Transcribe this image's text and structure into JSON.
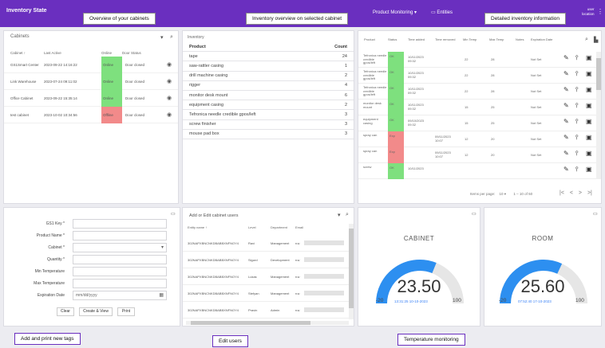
{
  "app": {
    "title": "Inventory State",
    "menu_label": "Product Monitoring ▾",
    "entities_label": "Entities",
    "user_line1": "user",
    "user_line2": "location"
  },
  "callouts": {
    "cabinets": "Overview of your cabinets",
    "inventory": "Inventory overview on selected cabinet",
    "detailed": "Detailed inventory information",
    "tags": "Add and print new tags",
    "users": "Edit users",
    "temp": "Temperature monitoring"
  },
  "cabinets": {
    "title": "Cabinets",
    "columns": [
      "Cabinet ↑",
      "Last Active",
      "Online",
      "Door Status"
    ],
    "rows": [
      {
        "name": "GS1Smart Center",
        "date": "2023-09-22 14:16:22",
        "online": "Online",
        "door": "Door closed",
        "ok": true
      },
      {
        "name": "Link Warehouse",
        "date": "2023-07-24 09:11:02",
        "online": "Online",
        "door": "Door closed",
        "ok": true
      },
      {
        "name": "Office Cabinet",
        "date": "2023-09-22 15:35:14",
        "online": "Online",
        "door": "Door closed",
        "ok": true
      },
      {
        "name": "test cabinet",
        "date": "2023-10-02 10:34:56",
        "online": "Offline",
        "door": "Door closed",
        "ok": false
      }
    ]
  },
  "inventory": {
    "title": "Inventory",
    "col_product": "Product",
    "col_count": "Count",
    "rows": [
      {
        "product": "tape",
        "count": "24"
      },
      {
        "product": "saw-rattler casing",
        "count": "1"
      },
      {
        "product": "drill machine casing",
        "count": "2"
      },
      {
        "product": "rigger",
        "count": "4"
      },
      {
        "product": "monitor desk mount",
        "count": "6"
      },
      {
        "product": "equipment casing",
        "count": "2"
      },
      {
        "product": "Tefronica needle credible gpos/left",
        "count": "3"
      },
      {
        "product": "screw finisher",
        "count": "3"
      },
      {
        "product": "mouse pad box",
        "count": "3"
      }
    ]
  },
  "detail": {
    "columns": [
      "Product",
      "Status",
      "Time added",
      "Time removed",
      "Min Temp",
      "Max Temp",
      "Notes",
      "Expiration Date"
    ],
    "rows": [
      {
        "product": "Tefronica needle credible gpos/left",
        "status": "OK",
        "added": "10/11/2023 09:32",
        "removed": "",
        "min": "22",
        "max": "28",
        "exp": "Not Set",
        "bad": false
      },
      {
        "product": "Tefronica needle credible gpos/left",
        "status": "OK",
        "added": "10/11/2023 09:32",
        "removed": "",
        "min": "22",
        "max": "28",
        "exp": "Not Set",
        "bad": false
      },
      {
        "product": "Tefronica needle credible gpos/left",
        "status": "OK",
        "added": "10/11/2023 09:32",
        "removed": "",
        "min": "22",
        "max": "28",
        "exp": "Not Set",
        "bad": false
      },
      {
        "product": "monitor desk mount",
        "status": "OK",
        "added": "10/11/2023 09:32",
        "removed": "",
        "min": "15",
        "max": "25",
        "exp": "Not Set",
        "bad": false
      },
      {
        "product": "equipment casing",
        "status": "OK",
        "added": "09/10/2023 09:32",
        "removed": "",
        "min": "15",
        "max": "25",
        "exp": "Not Set",
        "bad": false
      },
      {
        "product": "spray can",
        "status": "Exp",
        "added": "",
        "removed": "09/11/2023 10:07",
        "min": "12",
        "max": "20",
        "exp": "Not Set",
        "bad": true
      },
      {
        "product": "spray can",
        "status": "Exp",
        "added": "",
        "removed": "09/11/2023 10:07",
        "min": "12",
        "max": "20",
        "exp": "Not Set",
        "bad": true
      },
      {
        "product": "screw",
        "status": "OK",
        "added": "10/11/2023",
        "removed": "",
        "min": "",
        "max": "",
        "exp": "",
        "bad": false
      }
    ],
    "pager_label": "Items per page:",
    "pager_size": "10 ▾",
    "pager_range": "1 – 10 of 50"
  },
  "tags": {
    "fields": [
      {
        "label": "GS1 Key *",
        "value": ""
      },
      {
        "label": "Product Name *",
        "value": ""
      },
      {
        "label": "Cabinet *",
        "value": ""
      },
      {
        "label": "Quantity *",
        "value": ""
      },
      {
        "label": "Min Temperature",
        "value": ""
      },
      {
        "label": "Max Temperature",
        "value": ""
      },
      {
        "label": "Expiration Date",
        "value": "mm/dd/yyyy"
      }
    ],
    "buttons": [
      "Clear",
      "Create & View",
      "Print"
    ]
  },
  "users": {
    "title": "Add or Edit cabinet users",
    "columns": [
      "Entity name ↑",
      "Level",
      "Department",
      "Email"
    ],
    "rows": [
      {
        "id": "302NAPXBNCNKDBABBXNFNOY4",
        "level": "Ravi",
        "dept": "Management",
        "email": "ruv"
      },
      {
        "id": "302NAPXBNCNKDBABBXNFNOY4",
        "level": "Sigurd",
        "dept": "Development",
        "email": "ruv"
      },
      {
        "id": "302NAPXBNCNKDBABBXNFNOY4",
        "level": "Lukas",
        "dept": "Management",
        "email": "ruv"
      },
      {
        "id": "302NAPXBNCNKDBABBXNFNOY4",
        "level": "Stefyan",
        "dept": "Management",
        "email": "ruv"
      },
      {
        "id": "302NAPXBNCNKDBABBXNFNOY4",
        "level": "Pravin",
        "dept": "Admin",
        "email": "ruv"
      }
    ]
  },
  "gauges": [
    {
      "title": "CABINET",
      "value": "23.50",
      "level": 0.623,
      "min": "-20",
      "max": "100",
      "time": "13:31:25  10-10-2023"
    },
    {
      "title": "ROOM",
      "value": "25.60",
      "level": 0.638,
      "min": "-20",
      "max": "100",
      "time": "07:52:40  17-10-2023"
    }
  ],
  "colors": {
    "accent": "#6a2fbf",
    "gauge": "#2d8ff0",
    "online": "#7ee07e",
    "offline": "#f28a8a"
  }
}
